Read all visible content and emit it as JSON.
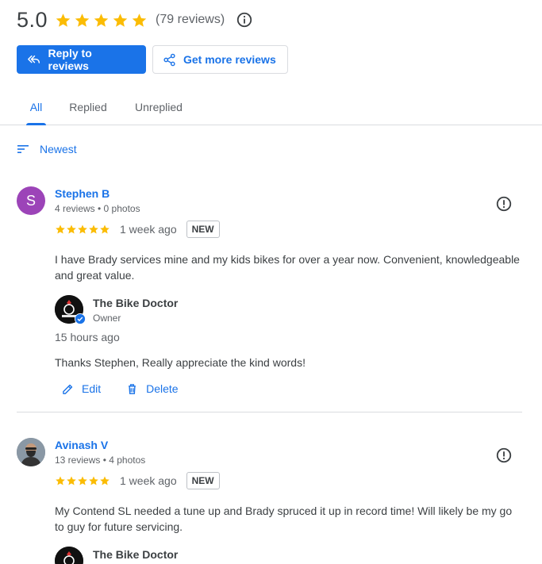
{
  "summary": {
    "rating": "5.0",
    "stars": 5,
    "review_count": "(79 reviews)",
    "star_color": "#fbbc04"
  },
  "buttons": {
    "reply": "Reply to reviews",
    "get_more": "Get more reviews"
  },
  "tabs": [
    {
      "label": "All",
      "active": true
    },
    {
      "label": "Replied",
      "active": false
    },
    {
      "label": "Unreplied",
      "active": false
    }
  ],
  "sort": {
    "label": "Newest"
  },
  "reviews": [
    {
      "name": "Stephen B",
      "meta": "4 reviews • 0 photos",
      "avatar_letter": "S",
      "avatar_color": "#9c44b8",
      "stars": 5,
      "date": "1 week ago",
      "badge": "NEW",
      "text": "I have Brady services mine and my kids bikes for over a year now. Convenient, knowledgeable and great value.",
      "reply": {
        "owner_name": "The Bike Doctor",
        "owner_role": "Owner",
        "date": "15 hours ago",
        "text": "Thanks Stephen, Really appreciate the kind words!",
        "edit_label": "Edit",
        "delete_label": "Delete"
      }
    },
    {
      "name": "Avinash V",
      "meta": "13 reviews • 4 photos",
      "stars": 5,
      "date": "1 week ago",
      "badge": "NEW",
      "text": "My Contend SL needed a tune up and Brady spruced it up in record time! Will likely be my go to guy for future servicing.",
      "reply": {
        "owner_name": "The Bike Doctor"
      }
    }
  ],
  "colors": {
    "accent": "#1a73e8",
    "text_secondary": "#5f6368",
    "divider": "#dadce0"
  }
}
